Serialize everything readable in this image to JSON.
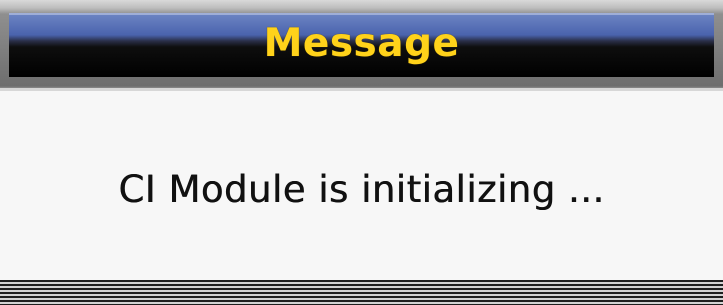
{
  "dialog": {
    "title": "Message",
    "message": "CI Module is initializing ..."
  },
  "colors": {
    "title_text": "#ffd21a",
    "title_bar_top": "#4a63ad",
    "title_bar_bottom": "#000000",
    "body_background": "#f7f7f7",
    "message_text": "#111111"
  }
}
